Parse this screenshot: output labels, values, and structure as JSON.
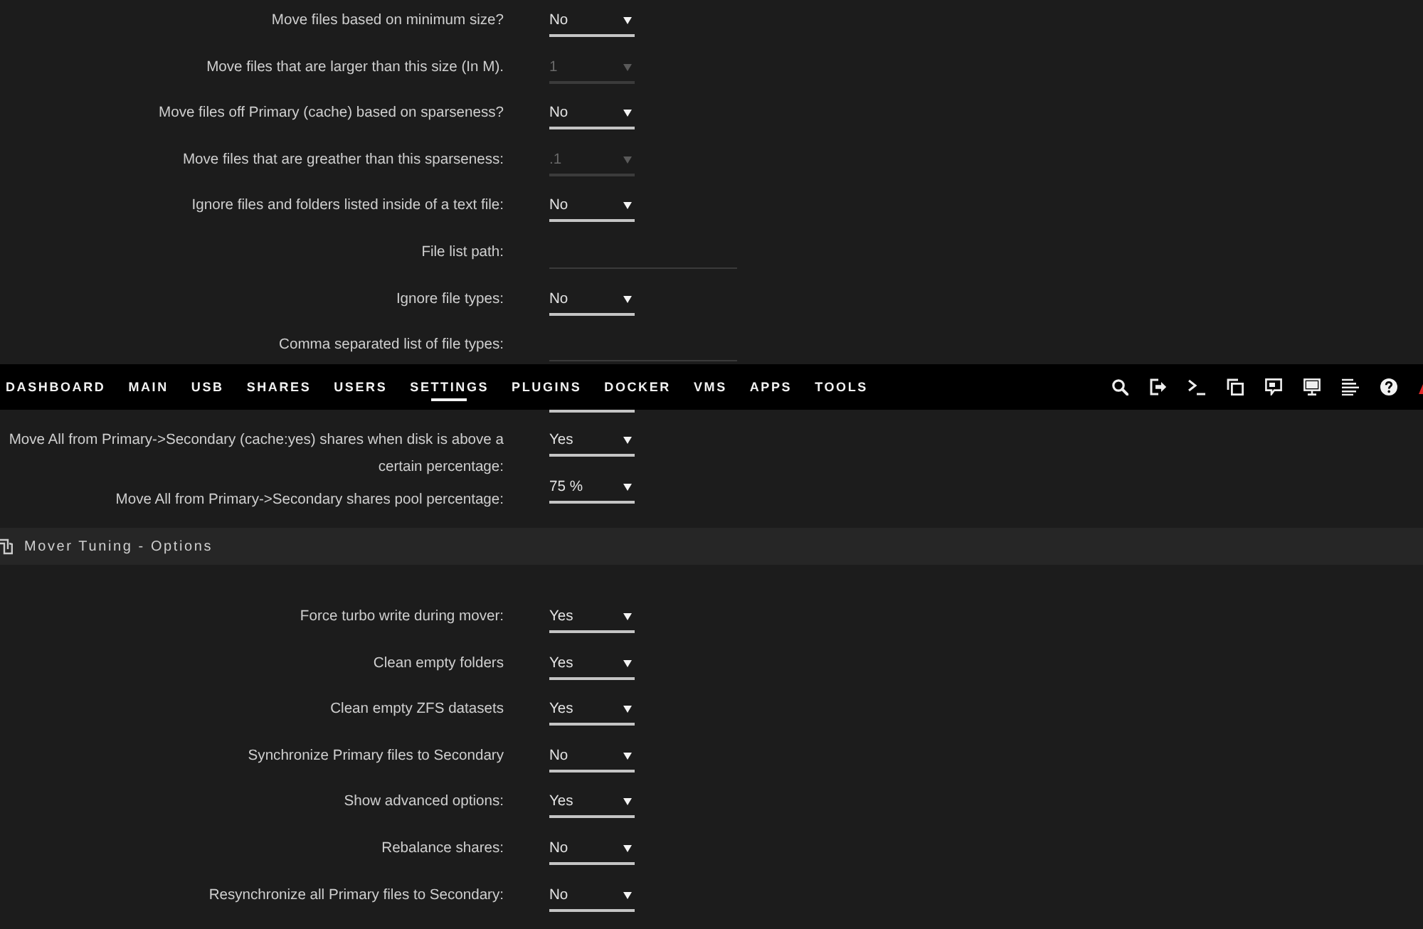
{
  "settings": [
    {
      "kind": "select",
      "label": "Move files based on minimum size?",
      "value": "No",
      "disabled": false
    },
    {
      "kind": "select",
      "label": "Move files that are larger than this size (In M).",
      "value": "1",
      "disabled": true
    },
    {
      "kind": "select",
      "label": "Move files off Primary (cache) based on sparseness?",
      "value": "No",
      "disabled": false
    },
    {
      "kind": "select",
      "label": "Move files that are greather than this sparseness:",
      "value": ".1",
      "disabled": true
    },
    {
      "kind": "select",
      "label": "Ignore files and folders listed inside of a text file:",
      "value": "No",
      "disabled": false
    },
    {
      "kind": "text",
      "label": "File list path:",
      "disabled": true
    },
    {
      "kind": "select",
      "label": "Ignore file types:",
      "value": "No",
      "disabled": false
    },
    {
      "kind": "text",
      "label": "Comma separated list of file types:",
      "disabled": true
    }
  ],
  "nav": {
    "tabs": [
      {
        "label": "DASHBOARD",
        "selected": false
      },
      {
        "label": "MAIN",
        "selected": false
      },
      {
        "label": "USB",
        "selected": false
      },
      {
        "label": "SHARES",
        "selected": false
      },
      {
        "label": "USERS",
        "selected": false
      },
      {
        "label": "SETTINGS",
        "selected": true
      },
      {
        "label": "PLUGINS",
        "selected": false
      },
      {
        "label": "DOCKER",
        "selected": false
      },
      {
        "label": "VMS",
        "selected": false
      },
      {
        "label": "APPS",
        "selected": false
      },
      {
        "label": "TOOLS",
        "selected": false
      }
    ]
  },
  "pool_settings": [
    {
      "label": "Move All from Primary->Secondary (cache:yes) shares when disk is above a certain percentage:",
      "value": "Yes",
      "disabled": false
    },
    {
      "label": "Move All from Primary->Secondary shares pool percentage:",
      "value": "75 %",
      "disabled": false
    }
  ],
  "section": {
    "title": "Mover Tuning - Options",
    "settings": [
      {
        "label": "Force turbo write during mover:",
        "value": "Yes",
        "disabled": false
      },
      {
        "label": "Clean empty folders",
        "value": "Yes",
        "disabled": false
      },
      {
        "label": "Clean empty ZFS datasets",
        "value": "Yes",
        "disabled": false
      },
      {
        "label": "Synchronize Primary files to Secondary",
        "value": "No",
        "disabled": false
      },
      {
        "label": "Show advanced options:",
        "value": "Yes",
        "disabled": false
      },
      {
        "label": "Rebalance shares:",
        "value": "No",
        "disabled": false
      },
      {
        "label": "Resynchronize all Primary files to Secondary:",
        "value": "No",
        "disabled": false
      }
    ]
  }
}
